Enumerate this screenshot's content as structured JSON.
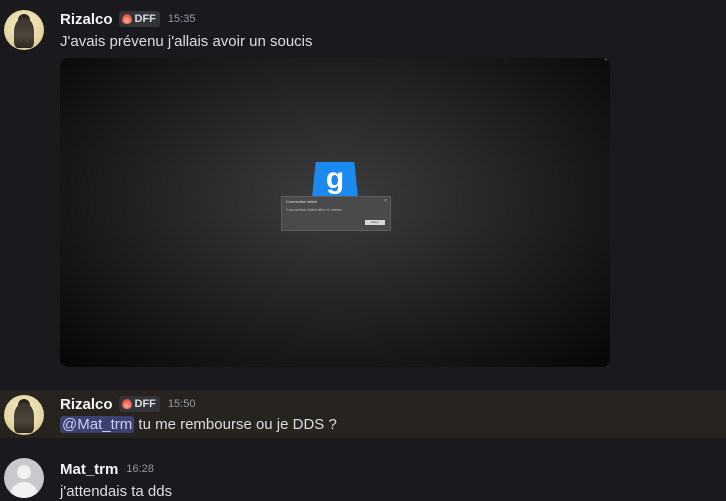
{
  "messages": [
    {
      "username": "Rizalco",
      "tag": "DFF",
      "time": "15:35",
      "text": "J'avais prévenu j'allais avoir un soucis",
      "embed": {
        "game_logo_letter": "g",
        "dialog": {
          "title": "Connection failed",
          "message": "Connection failed after 6 retries",
          "button": "Retry",
          "close": "×"
        }
      }
    },
    {
      "username": "Rizalco",
      "tag": "DFF",
      "time": "15:50",
      "mention": "@Mat_trm",
      "text": " tu me rembourse ou je DDS ?"
    },
    {
      "username": "Mat_trm",
      "time": "16:28",
      "text": "j'attendais ta dds"
    }
  ],
  "colors": {
    "background": "#1a1a1e",
    "highlight": "#27241f",
    "mention_bg": "#3c4270",
    "mention_text": "#c9cdfb",
    "timestamp": "#949ba4"
  }
}
